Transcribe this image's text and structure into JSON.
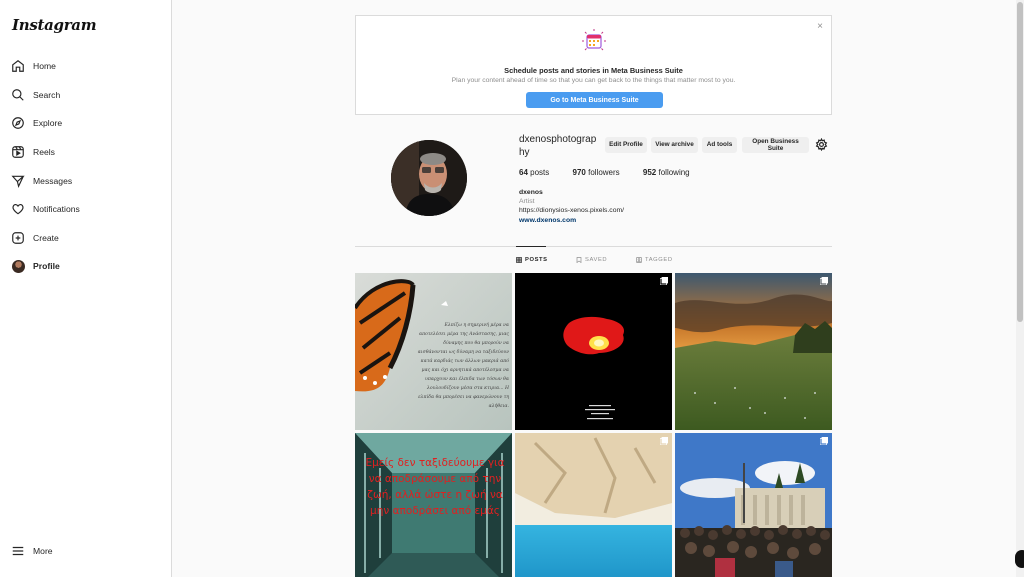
{
  "app": {
    "logo": "Instagram"
  },
  "sidebar": {
    "items": [
      {
        "label": "Home",
        "icon": "home-icon"
      },
      {
        "label": "Search",
        "icon": "search-icon"
      },
      {
        "label": "Explore",
        "icon": "compass-icon"
      },
      {
        "label": "Reels",
        "icon": "reels-icon"
      },
      {
        "label": "Messages",
        "icon": "paper-plane-icon"
      },
      {
        "label": "Notifications",
        "icon": "heart-icon"
      },
      {
        "label": "Create",
        "icon": "plus-square-icon"
      },
      {
        "label": "Profile",
        "icon": "avatar",
        "active": true
      }
    ],
    "more_label": "More"
  },
  "banner": {
    "title": "Schedule posts and stories in Meta Business Suite",
    "subtitle": "Plan your content ahead of time so that you can get back to the things that matter most to you.",
    "button": "Go to Meta Business Suite",
    "close": "×"
  },
  "profile": {
    "username": "dxenosphotography",
    "buttons": {
      "edit": "Edit Profile",
      "archive": "View archive",
      "ad_tools": "Ad tools",
      "business": "Open Business Suite"
    },
    "stats": {
      "posts_count": "64",
      "posts_label": "posts",
      "followers_count": "970",
      "followers_label": "followers",
      "following_count": "952",
      "following_label": "following"
    },
    "bio": {
      "name": "dxenos",
      "category": "Artist",
      "link1": "https://dionysios-xenos.pixels.com/",
      "link2": "www.dxenos.com"
    }
  },
  "tabs": {
    "posts": "POSTS",
    "saved": "SAVED",
    "tagged": "TAGGED"
  },
  "posts": [
    {
      "caption": "Ελπίζω η σημερινή μέρα να αποτελέσει μέρα της Ανάστασης, μιας δύναμης που θα μπορούν να αισθάνονται ως δύναμη να ταξιδεύουν κατά καρδιάς των άλλων μακριά από μας και όχι αρνητικά αποτέλεσμα να υπαρχουν και έλπιδα των τόσων θα λουλουδίζουν μέσα στα κτιρια... Η ελπίδα θα μπορέσει να φανερώνουν τη αλήθεια."
    },
    {
      "caption": ""
    },
    {
      "caption": ""
    },
    {
      "caption": "Εμείς δεν ταξιδεύουμε για να αποδράσουμε από την ζωή, αλλά ώστε η ζωή να μην αποδράσει από εμάς"
    },
    {
      "caption": ""
    },
    {
      "caption": ""
    }
  ]
}
